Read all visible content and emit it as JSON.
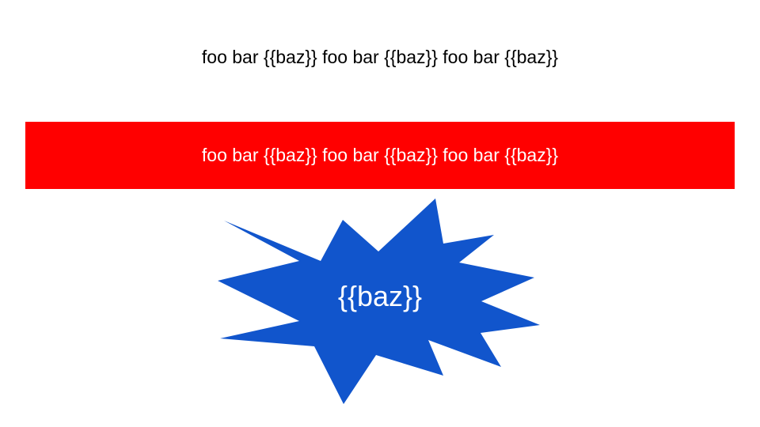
{
  "slide": {
    "top_text": "foo bar {{baz}} foo bar {{baz}} foo bar {{baz}}",
    "top_text_color": "#000000",
    "banner": {
      "text": "foo bar {{baz}} foo bar {{baz}} foo bar {{baz}}",
      "fill": "#ff0000",
      "text_color": "#ffffff"
    },
    "burst": {
      "text": "{{baz}}",
      "fill": "#1155cc",
      "text_color": "#ffffff"
    }
  }
}
